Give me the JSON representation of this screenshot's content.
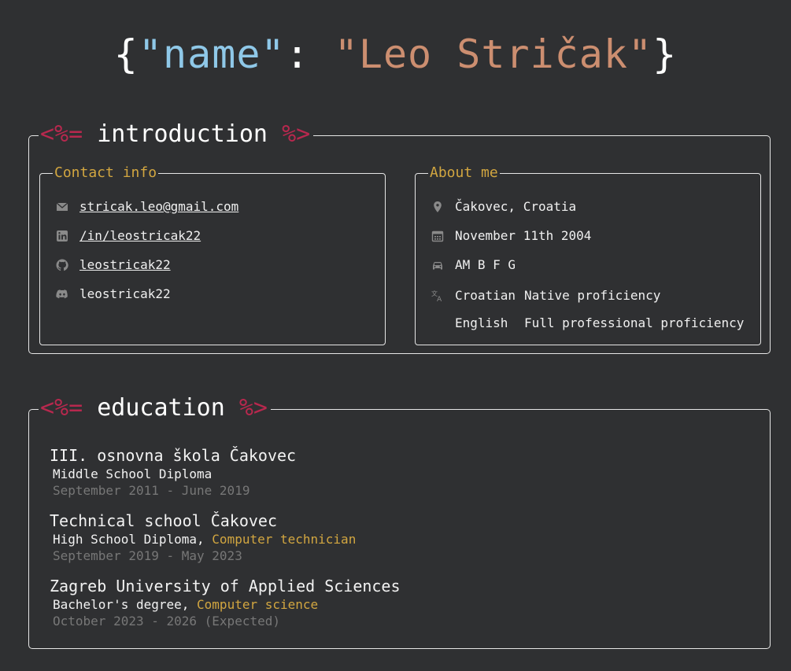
{
  "header": {
    "open_brace": "{",
    "key": "\"name\"",
    "colon": ": ",
    "value": "\"Leo Stričak\"",
    "close_brace": "}"
  },
  "introduction": {
    "tag_open": "<%=",
    "title": "introduction",
    "tag_close": "%>",
    "contact": {
      "title": "Contact info",
      "email": "stricak.leo@gmail.com",
      "linkedin": "/in/leostricak22",
      "github": "leostricak22",
      "discord": "leostricak22"
    },
    "about": {
      "title": "About me",
      "location": "Čakovec, Croatia",
      "birthday": "November 11th 2004",
      "license": "AM B F G",
      "languages": [
        {
          "name": "Croatian",
          "level": "Native proficiency"
        },
        {
          "name": "English",
          "level": "Full professional proficiency"
        }
      ]
    }
  },
  "education": {
    "tag_open": "<%=",
    "title": "education",
    "tag_close": "%>",
    "items": [
      {
        "school": "III. osnovna škola Čakovec",
        "degree": "Middle School Diploma",
        "field": "",
        "dates": "September 2011 - June 2019"
      },
      {
        "school": "Technical school Čakovec",
        "degree": "High School Diploma,",
        "field": "Computer technician",
        "dates": "September 2019 - May 2023"
      },
      {
        "school": "Zagreb University of Applied Sciences",
        "degree": "Bachelor's degree,",
        "field": "Computer science",
        "dates": "October 2023 - 2026 (Expected)"
      }
    ]
  },
  "colors": {
    "background": "#2f3032",
    "accent_tag": "#b8284e",
    "accent_gold": "#d2a640",
    "key_blue": "#8fc8e8",
    "value_orange": "#cc8e70"
  },
  "icons": [
    "mail-icon",
    "linkedin-icon",
    "github-icon",
    "discord-icon",
    "location-pin-icon",
    "calendar-icon",
    "car-icon",
    "translate-icon"
  ]
}
